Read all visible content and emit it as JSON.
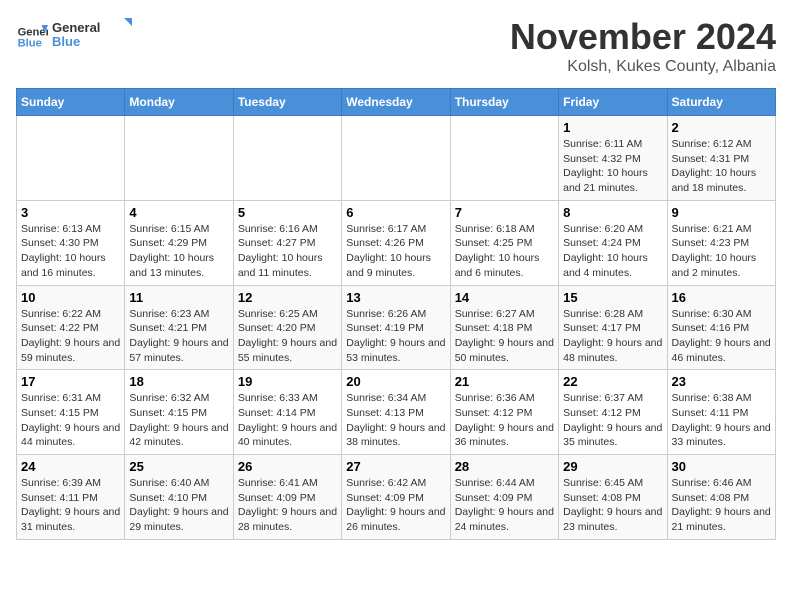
{
  "logo": {
    "line1": "General",
    "line2": "Blue"
  },
  "title": "November 2024",
  "location": "Kolsh, Kukes County, Albania",
  "days_header": [
    "Sunday",
    "Monday",
    "Tuesday",
    "Wednesday",
    "Thursday",
    "Friday",
    "Saturday"
  ],
  "weeks": [
    [
      {
        "day": "",
        "info": ""
      },
      {
        "day": "",
        "info": ""
      },
      {
        "day": "",
        "info": ""
      },
      {
        "day": "",
        "info": ""
      },
      {
        "day": "",
        "info": ""
      },
      {
        "day": "1",
        "info": "Sunrise: 6:11 AM\nSunset: 4:32 PM\nDaylight: 10 hours and 21 minutes."
      },
      {
        "day": "2",
        "info": "Sunrise: 6:12 AM\nSunset: 4:31 PM\nDaylight: 10 hours and 18 minutes."
      }
    ],
    [
      {
        "day": "3",
        "info": "Sunrise: 6:13 AM\nSunset: 4:30 PM\nDaylight: 10 hours and 16 minutes."
      },
      {
        "day": "4",
        "info": "Sunrise: 6:15 AM\nSunset: 4:29 PM\nDaylight: 10 hours and 13 minutes."
      },
      {
        "day": "5",
        "info": "Sunrise: 6:16 AM\nSunset: 4:27 PM\nDaylight: 10 hours and 11 minutes."
      },
      {
        "day": "6",
        "info": "Sunrise: 6:17 AM\nSunset: 4:26 PM\nDaylight: 10 hours and 9 minutes."
      },
      {
        "day": "7",
        "info": "Sunrise: 6:18 AM\nSunset: 4:25 PM\nDaylight: 10 hours and 6 minutes."
      },
      {
        "day": "8",
        "info": "Sunrise: 6:20 AM\nSunset: 4:24 PM\nDaylight: 10 hours and 4 minutes."
      },
      {
        "day": "9",
        "info": "Sunrise: 6:21 AM\nSunset: 4:23 PM\nDaylight: 10 hours and 2 minutes."
      }
    ],
    [
      {
        "day": "10",
        "info": "Sunrise: 6:22 AM\nSunset: 4:22 PM\nDaylight: 9 hours and 59 minutes."
      },
      {
        "day": "11",
        "info": "Sunrise: 6:23 AM\nSunset: 4:21 PM\nDaylight: 9 hours and 57 minutes."
      },
      {
        "day": "12",
        "info": "Sunrise: 6:25 AM\nSunset: 4:20 PM\nDaylight: 9 hours and 55 minutes."
      },
      {
        "day": "13",
        "info": "Sunrise: 6:26 AM\nSunset: 4:19 PM\nDaylight: 9 hours and 53 minutes."
      },
      {
        "day": "14",
        "info": "Sunrise: 6:27 AM\nSunset: 4:18 PM\nDaylight: 9 hours and 50 minutes."
      },
      {
        "day": "15",
        "info": "Sunrise: 6:28 AM\nSunset: 4:17 PM\nDaylight: 9 hours and 48 minutes."
      },
      {
        "day": "16",
        "info": "Sunrise: 6:30 AM\nSunset: 4:16 PM\nDaylight: 9 hours and 46 minutes."
      }
    ],
    [
      {
        "day": "17",
        "info": "Sunrise: 6:31 AM\nSunset: 4:15 PM\nDaylight: 9 hours and 44 minutes."
      },
      {
        "day": "18",
        "info": "Sunrise: 6:32 AM\nSunset: 4:15 PM\nDaylight: 9 hours and 42 minutes."
      },
      {
        "day": "19",
        "info": "Sunrise: 6:33 AM\nSunset: 4:14 PM\nDaylight: 9 hours and 40 minutes."
      },
      {
        "day": "20",
        "info": "Sunrise: 6:34 AM\nSunset: 4:13 PM\nDaylight: 9 hours and 38 minutes."
      },
      {
        "day": "21",
        "info": "Sunrise: 6:36 AM\nSunset: 4:12 PM\nDaylight: 9 hours and 36 minutes."
      },
      {
        "day": "22",
        "info": "Sunrise: 6:37 AM\nSunset: 4:12 PM\nDaylight: 9 hours and 35 minutes."
      },
      {
        "day": "23",
        "info": "Sunrise: 6:38 AM\nSunset: 4:11 PM\nDaylight: 9 hours and 33 minutes."
      }
    ],
    [
      {
        "day": "24",
        "info": "Sunrise: 6:39 AM\nSunset: 4:11 PM\nDaylight: 9 hours and 31 minutes."
      },
      {
        "day": "25",
        "info": "Sunrise: 6:40 AM\nSunset: 4:10 PM\nDaylight: 9 hours and 29 minutes."
      },
      {
        "day": "26",
        "info": "Sunrise: 6:41 AM\nSunset: 4:09 PM\nDaylight: 9 hours and 28 minutes."
      },
      {
        "day": "27",
        "info": "Sunrise: 6:42 AM\nSunset: 4:09 PM\nDaylight: 9 hours and 26 minutes."
      },
      {
        "day": "28",
        "info": "Sunrise: 6:44 AM\nSunset: 4:09 PM\nDaylight: 9 hours and 24 minutes."
      },
      {
        "day": "29",
        "info": "Sunrise: 6:45 AM\nSunset: 4:08 PM\nDaylight: 9 hours and 23 minutes."
      },
      {
        "day": "30",
        "info": "Sunrise: 6:46 AM\nSunset: 4:08 PM\nDaylight: 9 hours and 21 minutes."
      }
    ]
  ]
}
